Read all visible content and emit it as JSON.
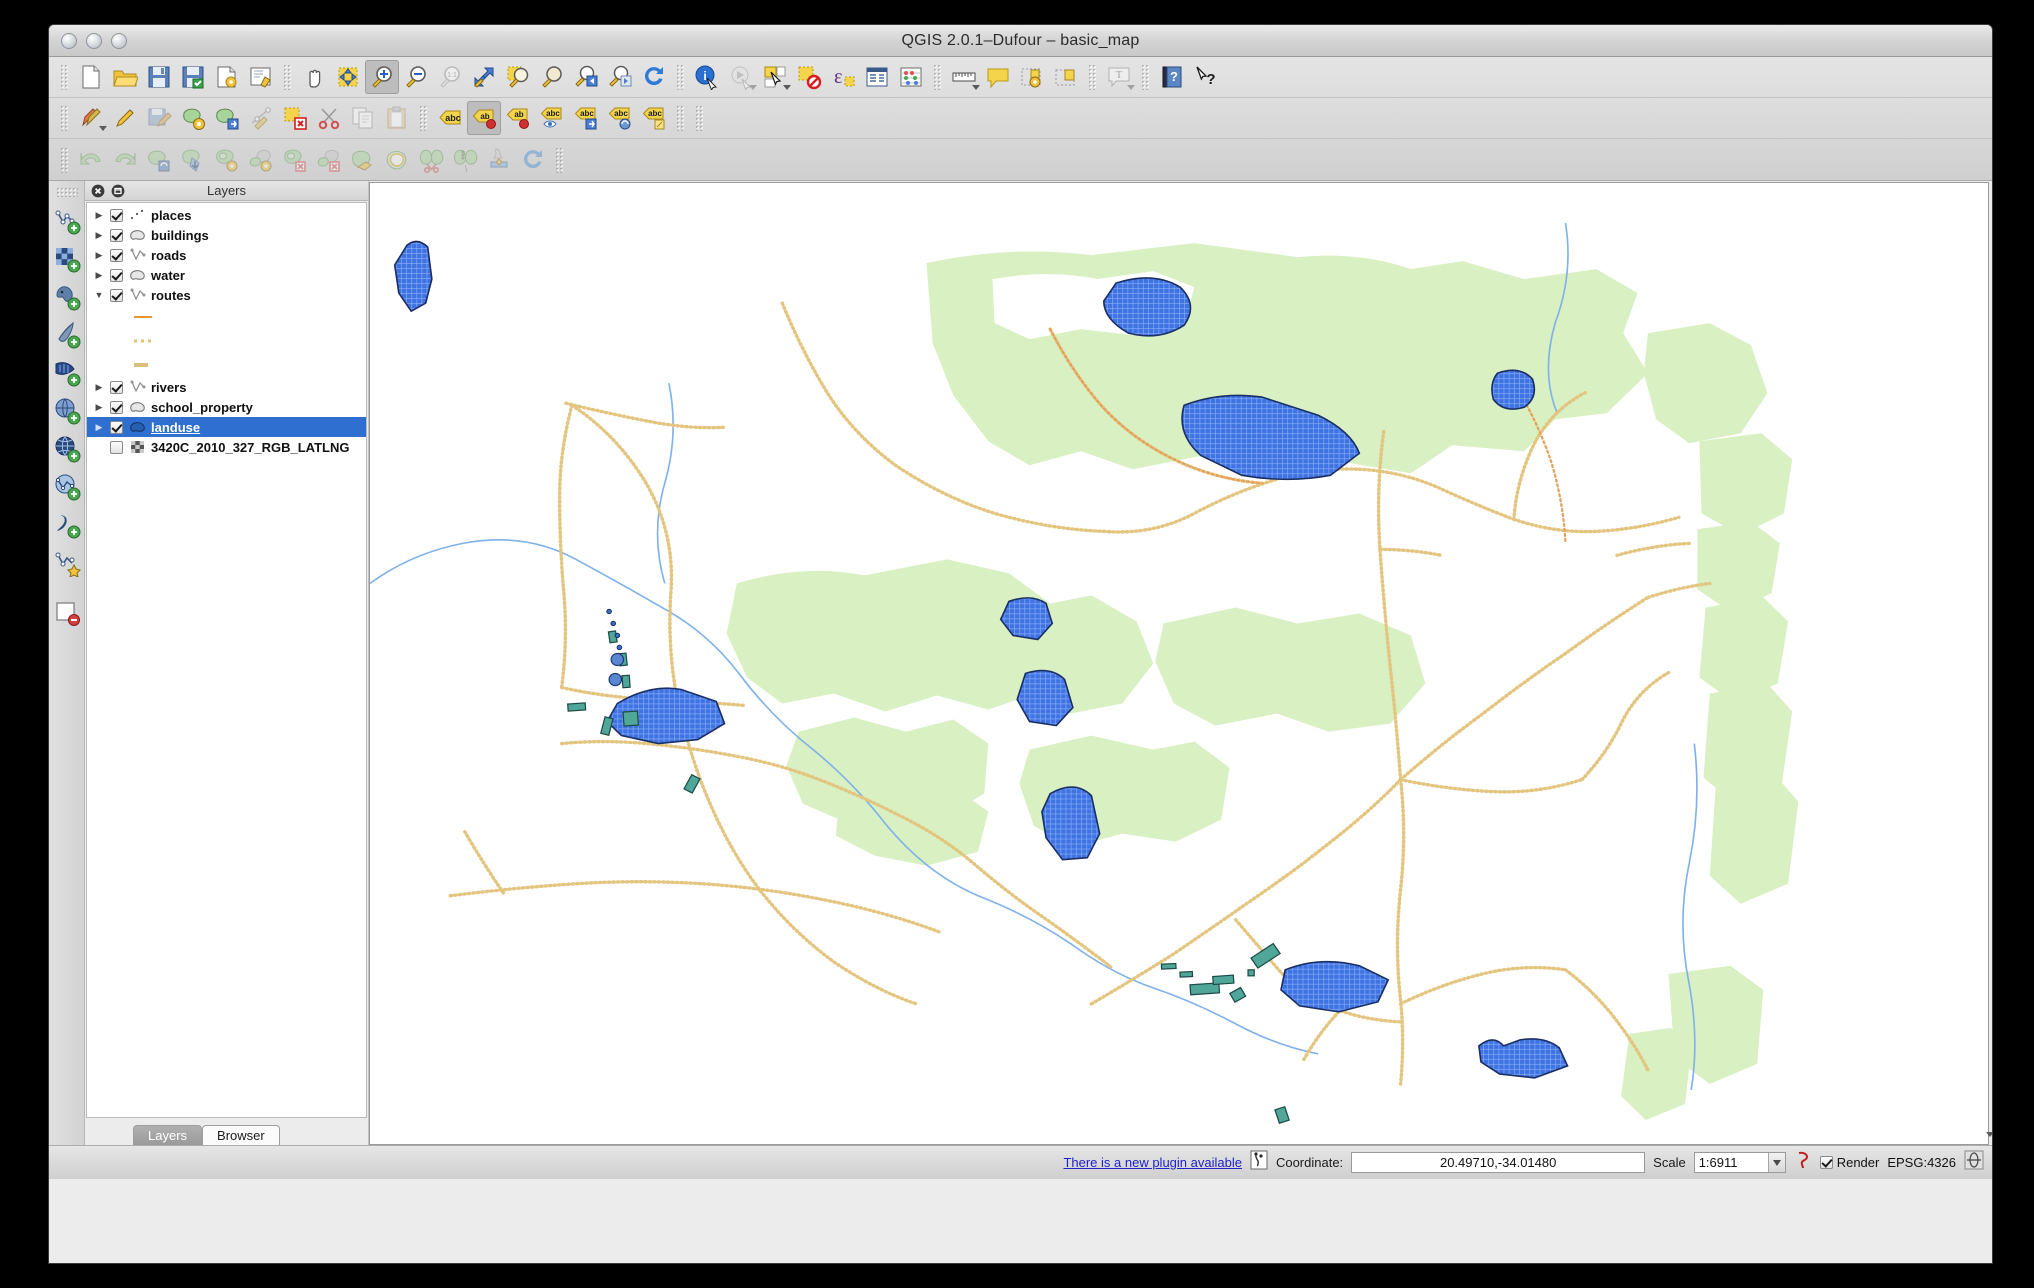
{
  "window": {
    "title": "QGIS 2.0.1–Dufour – basic_map",
    "traffic_lights": [
      "close",
      "minimize",
      "zoom"
    ]
  },
  "toolbars": {
    "row1": [
      {
        "name": "new-project-icon",
        "tip": "New Project"
      },
      {
        "name": "open-project-icon",
        "tip": "Open Project"
      },
      {
        "name": "save-project-icon",
        "tip": "Save Project"
      },
      {
        "name": "save-project-as-icon",
        "tip": "Save Project As"
      },
      {
        "name": "new-print-composer-icon",
        "tip": "New Print Composer"
      },
      {
        "name": "composer-manager-icon",
        "tip": "Composer Manager"
      },
      {
        "name": "pan-map-icon",
        "tip": "Pan Map"
      },
      {
        "name": "pan-to-selection-icon",
        "tip": "Pan Map to Selection"
      },
      {
        "name": "zoom-in-icon",
        "tip": "Zoom In"
      },
      {
        "name": "zoom-out-icon",
        "tip": "Zoom Out"
      },
      {
        "name": "zoom-native-icon",
        "tip": "Zoom to Native Resolution"
      },
      {
        "name": "zoom-full-icon",
        "tip": "Zoom Full"
      },
      {
        "name": "zoom-to-selection-icon",
        "tip": "Zoom to Selection"
      },
      {
        "name": "zoom-to-layer-icon",
        "tip": "Zoom to Layer"
      },
      {
        "name": "zoom-last-icon",
        "tip": "Zoom Last"
      },
      {
        "name": "zoom-next-icon",
        "tip": "Zoom Next"
      },
      {
        "name": "refresh-icon",
        "tip": "Refresh"
      },
      {
        "name": "identify-features-icon",
        "tip": "Identify Features"
      },
      {
        "name": "run-feature-action-icon",
        "tip": "Run Feature Action"
      },
      {
        "name": "select-features-icon",
        "tip": "Select Features"
      },
      {
        "name": "deselect-features-icon",
        "tip": "Deselect Features"
      },
      {
        "name": "select-by-expression-icon",
        "tip": "Select by Expression"
      },
      {
        "name": "open-attribute-table-icon",
        "tip": "Open Attribute Table"
      },
      {
        "name": "statistics-icon",
        "tip": "Show Statistics"
      },
      {
        "name": "measure-line-icon",
        "tip": "Measure Line"
      },
      {
        "name": "map-tips-icon",
        "tip": "Map Tips"
      },
      {
        "name": "new-bookmark-icon",
        "tip": "New Bookmark"
      },
      {
        "name": "show-bookmarks-icon",
        "tip": "Show Bookmarks"
      },
      {
        "name": "text-annotation-icon",
        "tip": "Text Annotation"
      },
      {
        "name": "help-icon",
        "tip": "Help Contents"
      },
      {
        "name": "whats-this-icon",
        "tip": "What's This?"
      }
    ],
    "row2": [
      {
        "name": "current-edits-icon",
        "tip": "Current Edits"
      },
      {
        "name": "toggle-editing-icon",
        "tip": "Toggle Editing"
      },
      {
        "name": "save-layer-edits-icon",
        "tip": "Save Layer Edits"
      },
      {
        "name": "add-feature-icon",
        "tip": "Add Feature"
      },
      {
        "name": "move-feature-icon",
        "tip": "Move Feature"
      },
      {
        "name": "node-tool-icon",
        "tip": "Node Tool"
      },
      {
        "name": "delete-selected-icon",
        "tip": "Delete Selected"
      },
      {
        "name": "cut-features-icon",
        "tip": "Cut Features"
      },
      {
        "name": "copy-features-icon",
        "tip": "Copy Features"
      },
      {
        "name": "paste-features-icon",
        "tip": "Paste Features"
      },
      {
        "name": "label-icon",
        "tip": "Layer Labeling Options"
      },
      {
        "name": "change-label-icon",
        "tip": "Change Label"
      },
      {
        "name": "pin-label-icon",
        "tip": "Pin/Unpin Labels"
      },
      {
        "name": "show-hide-label-icon",
        "tip": "Show/Hide Labels"
      },
      {
        "name": "move-label-icon",
        "tip": "Move Label"
      },
      {
        "name": "rotate-label-icon",
        "tip": "Rotate Label"
      },
      {
        "name": "change-label-properties-icon",
        "tip": "Change Label Properties"
      }
    ],
    "row3": [
      {
        "name": "undo-icon",
        "tip": "Undo"
      },
      {
        "name": "redo-icon",
        "tip": "Redo"
      },
      {
        "name": "rotate-feature-icon",
        "tip": "Rotate Feature"
      },
      {
        "name": "simplify-feature-icon",
        "tip": "Simplify Feature"
      },
      {
        "name": "add-ring-icon",
        "tip": "Add Ring"
      },
      {
        "name": "add-part-icon",
        "tip": "Add Part"
      },
      {
        "name": "delete-ring-icon",
        "tip": "Delete Ring"
      },
      {
        "name": "delete-part-icon",
        "tip": "Delete Part"
      },
      {
        "name": "reshape-features-icon",
        "tip": "Reshape Features"
      },
      {
        "name": "offset-curve-icon",
        "tip": "Offset Curve"
      },
      {
        "name": "split-features-icon",
        "tip": "Split Features"
      },
      {
        "name": "split-parts-icon",
        "tip": "Split Parts"
      },
      {
        "name": "merge-features-icon",
        "tip": "Merge Selected Features"
      },
      {
        "name": "rotate-point-symbols-icon",
        "tip": "Rotate Point Symbols"
      }
    ],
    "vertical": [
      {
        "name": "add-vector-layer-icon",
        "tip": "Add Vector Layer"
      },
      {
        "name": "add-raster-layer-icon",
        "tip": "Add Raster Layer"
      },
      {
        "name": "add-postgis-layer-icon",
        "tip": "Add PostGIS Layer"
      },
      {
        "name": "add-spatialite-layer-icon",
        "tip": "Add SpatiaLite Layer"
      },
      {
        "name": "add-mssql-layer-icon",
        "tip": "Add MSSQL Spatial Layer"
      },
      {
        "name": "add-wcs-layer-icon",
        "tip": "Add WCS Layer"
      },
      {
        "name": "add-wms-layer-icon",
        "tip": "Add WMS/WMTS Layer"
      },
      {
        "name": "add-wfs-layer-icon",
        "tip": "Add WFS Layer"
      },
      {
        "name": "add-delimited-text-layer-icon",
        "tip": "Add Delimited Text Layer"
      },
      {
        "name": "new-shapefile-layer-icon",
        "tip": "New Shapefile Layer"
      },
      {
        "name": "remove-layer-icon",
        "tip": "Remove Layer"
      }
    ]
  },
  "panel": {
    "title": "Layers",
    "header_icons": [
      "close-panel-icon",
      "undock-panel-icon"
    ],
    "layers": [
      {
        "name": "places",
        "checked": true,
        "expandable": true,
        "expanded": false,
        "selected": false,
        "symbol": "points"
      },
      {
        "name": "buildings",
        "checked": true,
        "expandable": true,
        "expanded": false,
        "selected": false,
        "symbol": "polygon"
      },
      {
        "name": "roads",
        "checked": true,
        "expandable": true,
        "expanded": false,
        "selected": false,
        "symbol": "line"
      },
      {
        "name": "water",
        "checked": true,
        "expandable": true,
        "expanded": false,
        "selected": false,
        "symbol": "polygon"
      },
      {
        "name": "routes",
        "checked": true,
        "expandable": true,
        "expanded": true,
        "selected": false,
        "symbol": "line"
      },
      {
        "name": "rivers",
        "checked": true,
        "expandable": true,
        "expanded": false,
        "selected": false,
        "symbol": "line"
      },
      {
        "name": "school_property",
        "checked": true,
        "expandable": true,
        "expanded": false,
        "selected": false,
        "symbol": "polygon"
      },
      {
        "name": "landuse",
        "checked": true,
        "expandable": true,
        "expanded": false,
        "selected": true,
        "symbol": "polygon"
      },
      {
        "name": "3420C_2010_327_RGB_LATLNG",
        "checked": false,
        "expandable": false,
        "expanded": false,
        "selected": false,
        "symbol": "raster"
      }
    ],
    "routes_subsymbols": [
      {
        "style": "solid",
        "color": "#e8962e"
      },
      {
        "style": "dotted",
        "color": "#e0c271"
      },
      {
        "style": "thick",
        "color": "#ddbf7c"
      }
    ],
    "tabs": [
      {
        "label": "Layers",
        "active": true
      },
      {
        "label": "Browser",
        "active": false
      }
    ]
  },
  "status": {
    "plugin_message": "There is a new plugin available",
    "plugin_icon": "plugin-icon",
    "coordinate_label": "Coordinate:",
    "coordinate_value": "20.49710,-34.01480",
    "scale_label": "Scale",
    "scale_value": "1:6911",
    "magnifier_icon": "magnifier-icon",
    "render_label": "Render",
    "render_checked": true,
    "crs": "EPSG:4326",
    "crs_icon": "crs-status-icon"
  },
  "map": {
    "background": "#ffffff",
    "colors": {
      "landuse_fill": "#d8f0c2",
      "water_fill": "#4d7fe8",
      "water_hatch": "#7fa8f2",
      "water_stroke": "#1a2f66",
      "road": "#e3c57f",
      "road_major": "#e5a05c",
      "river": "#7fb2ea",
      "building_fill": "#4fa699",
      "building_stroke": "#1d4a44"
    }
  }
}
